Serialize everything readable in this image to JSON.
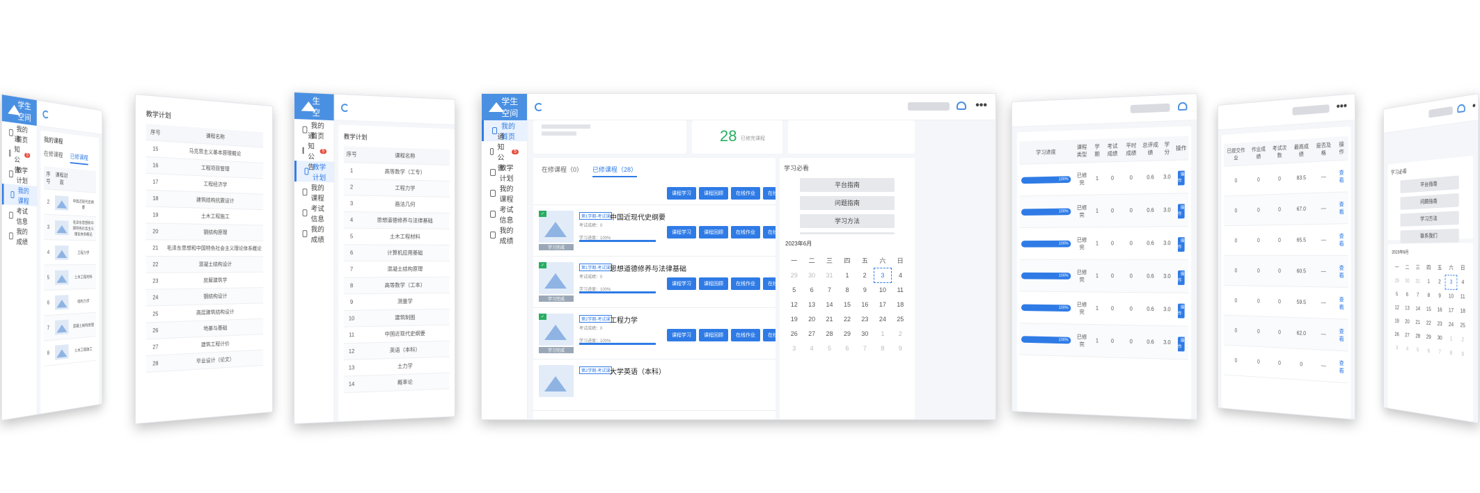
{
  "brand": {
    "name": "学生空间"
  },
  "nav": [
    {
      "label": "我的首页",
      "icon": "home-icon"
    },
    {
      "label": "通知公告",
      "icon": "speaker-icon",
      "badge": "5"
    },
    {
      "label": "教学计划",
      "icon": "doc-icon"
    },
    {
      "label": "我的课程",
      "icon": "user-icon"
    },
    {
      "label": "考试信息",
      "icon": "edit-icon"
    },
    {
      "label": "我的成绩",
      "icon": "grade-icon"
    }
  ],
  "plan": {
    "title": "教学计划",
    "headers": [
      "序号",
      "课程名称"
    ],
    "rows": [
      {
        "no": "15",
        "name": "马克思主义基本原理概论"
      },
      {
        "no": "16",
        "name": "工程项目管理"
      },
      {
        "no": "17",
        "name": "工程经济学"
      },
      {
        "no": "18",
        "name": "建筑结构抗震设计"
      },
      {
        "no": "19",
        "name": "土木工程施工"
      },
      {
        "no": "20",
        "name": "钢结构原理"
      },
      {
        "no": "21",
        "name": "毛泽东思想和中国特色社会主义理论体系概论"
      },
      {
        "no": "22",
        "name": "混凝土结构设计"
      },
      {
        "no": "23",
        "name": "房屋建筑学"
      },
      {
        "no": "24",
        "name": "钢结构设计"
      },
      {
        "no": "25",
        "name": "高层建筑结构设计"
      },
      {
        "no": "26",
        "name": "地基与基础"
      },
      {
        "no": "27",
        "name": "建筑工程计价"
      },
      {
        "no": "28",
        "name": "毕业设计（论文）"
      }
    ]
  },
  "plan2": {
    "title": "教学计划",
    "headers": [
      "序号",
      "课程名称"
    ],
    "rows": [
      {
        "no": "1",
        "name": "高等数学（工专）"
      },
      {
        "no": "2",
        "name": "工程力学"
      },
      {
        "no": "3",
        "name": "画法几何"
      },
      {
        "no": "4",
        "name": "思想道德修养与法律基础"
      },
      {
        "no": "5",
        "name": "土木工程材料"
      },
      {
        "no": "6",
        "name": "计算机应用基础"
      },
      {
        "no": "7",
        "name": "混凝土结构原理"
      },
      {
        "no": "8",
        "name": "高等数学（工本）"
      },
      {
        "no": "9",
        "name": "测量学"
      },
      {
        "no": "10",
        "name": "建筑制图"
      },
      {
        "no": "11",
        "name": "中国近现代史纲要"
      },
      {
        "no": "12",
        "name": "英语（本科）"
      },
      {
        "no": "13",
        "name": "土力学"
      },
      {
        "no": "14",
        "name": "概率论"
      }
    ]
  },
  "mycourse": {
    "title": "我的课程",
    "tabs": [
      "在修课程",
      "已修课程"
    ],
    "headers": [
      "序号",
      "课程封面"
    ],
    "rows": [
      "2",
      "3",
      "4",
      "5",
      "6",
      "7",
      "8"
    ],
    "labels": [
      "中国近现代史纲要",
      "毛泽东思想和中国特色社会主义理论体系概论",
      "工程力学",
      "土木工程材料",
      "结构力学",
      "混凝土结构原理",
      "土木工程施工"
    ]
  },
  "home": {
    "summary_number": "28",
    "summary_label": "已修完课程",
    "tabs": [
      "在修课程（0）",
      "已修课程（28）"
    ],
    "courses": [
      {
        "tag": "第1学期-考试课",
        "name": "中国近现代史纲要",
        "meta": "考试成绩：0",
        "progress_label": "学习进度：100%",
        "progress": 1.0,
        "status": "学习完成"
      },
      {
        "tag": "第1学期-考试课",
        "name": "思想道德修养与法律基础",
        "meta": "考试成绩：0",
        "progress_label": "学习进度：100%",
        "progress": 1.0,
        "status": "学习完成"
      },
      {
        "tag": "第2学期-考试课",
        "name": "工程力学",
        "meta": "考试成绩：0",
        "progress_label": "学习进度：100%",
        "progress": 1.0,
        "status": "学习完成"
      },
      {
        "tag": "第2学期-考试课",
        "name": "大学英语（本科）",
        "meta": "",
        "progress_label": "",
        "progress": 1.0,
        "status": ""
      }
    ],
    "course_buttons": [
      "课程学习",
      "课程回顾",
      "在线作业",
      "在线测试"
    ],
    "help_title": "学习必看",
    "help_buttons": [
      "平台指南",
      "问题指南",
      "学习方法",
      "联系我们"
    ],
    "calendar_title": "2023年6月",
    "weekdays": [
      "一",
      "二",
      "三",
      "四",
      "五",
      "六",
      "日"
    ],
    "calendar": [
      [
        "29",
        "30",
        "31",
        "1",
        "2",
        "3",
        "4"
      ],
      [
        "5",
        "6",
        "7",
        "8",
        "9",
        "10",
        "11"
      ],
      [
        "12",
        "13",
        "14",
        "15",
        "16",
        "17",
        "18"
      ],
      [
        "19",
        "20",
        "21",
        "22",
        "23",
        "24",
        "25"
      ],
      [
        "26",
        "27",
        "28",
        "29",
        "30",
        "1",
        "2"
      ],
      [
        "3",
        "4",
        "5",
        "6",
        "7",
        "8",
        "9"
      ]
    ]
  },
  "grades": {
    "headers": [
      "学习进度",
      "课程类型",
      "学期",
      "考试成绩",
      "平时成绩",
      "总评成绩",
      "学分",
      "操作"
    ],
    "rows": [
      {
        "type": "已修完",
        "a": "1",
        "b": "0",
        "c": "0",
        "d": "0.6",
        "e": "3.0",
        "op": "操作"
      },
      {
        "type": "已修完",
        "a": "1",
        "b": "0",
        "c": "0",
        "d": "0.6",
        "e": "3.0",
        "op": "操作"
      },
      {
        "type": "已修完",
        "a": "1",
        "b": "0",
        "c": "0",
        "d": "0.6",
        "e": "3.0",
        "op": "操作"
      },
      {
        "type": "已修完",
        "a": "1",
        "b": "0",
        "c": "0",
        "d": "0.6",
        "e": "3.0",
        "op": "操作"
      },
      {
        "type": "已修完",
        "a": "1",
        "b": "0",
        "c": "0",
        "d": "0.6",
        "e": "3.0",
        "op": "操作"
      },
      {
        "type": "已修完",
        "a": "1",
        "b": "0",
        "c": "0",
        "d": "0.6",
        "e": "3.0",
        "op": "操作"
      }
    ],
    "bar_label": "100%"
  },
  "exam": {
    "headers": [
      "已提交作业",
      "作业成绩",
      "考试次数",
      "最高成绩",
      "是否及格",
      "操作"
    ],
    "rows": [
      {
        "a": "0",
        "b": "0",
        "c": "0",
        "d": "83.5",
        "e": "—",
        "f": "查看"
      },
      {
        "a": "0",
        "b": "0",
        "c": "0",
        "d": "67.0",
        "e": "—",
        "f": "查看"
      },
      {
        "a": "0",
        "b": "0",
        "c": "0",
        "d": "65.5",
        "e": "—",
        "f": "查看"
      },
      {
        "a": "0",
        "b": "0",
        "c": "0",
        "d": "60.5",
        "e": "—",
        "f": "查看"
      },
      {
        "a": "0",
        "b": "0",
        "c": "0",
        "d": "59.5",
        "e": "—",
        "f": "查看"
      },
      {
        "a": "0",
        "b": "0",
        "c": "0",
        "d": "62.0",
        "e": "—",
        "f": "查看"
      },
      {
        "a": "0",
        "b": "0",
        "c": "0",
        "d": "0",
        "e": "—",
        "f": "查看"
      }
    ]
  },
  "right_help": {
    "title": "学习必看",
    "buttons": [
      "平台指南",
      "问题指南",
      "学习方法",
      "联系我们"
    ],
    "calendar_title": "2023年6月",
    "weekdays": [
      "一",
      "二",
      "三",
      "四",
      "五",
      "六",
      "日"
    ],
    "calendar": [
      [
        "29",
        "30",
        "31",
        "1",
        "2",
        "3",
        "4"
      ],
      [
        "5",
        "6",
        "7",
        "8",
        "9",
        "10",
        "11"
      ],
      [
        "12",
        "13",
        "14",
        "15",
        "16",
        "17",
        "18"
      ],
      [
        "19",
        "20",
        "21",
        "22",
        "23",
        "24",
        "25"
      ],
      [
        "26",
        "27",
        "28",
        "29",
        "30",
        "1",
        "2"
      ],
      [
        "3",
        "4",
        "5",
        "6",
        "7",
        "8",
        "9"
      ]
    ]
  },
  "colors": {
    "primary": "#2f7be6",
    "brand": "#4a90e2",
    "success": "#27ae60",
    "badge": "#e74c3c"
  }
}
